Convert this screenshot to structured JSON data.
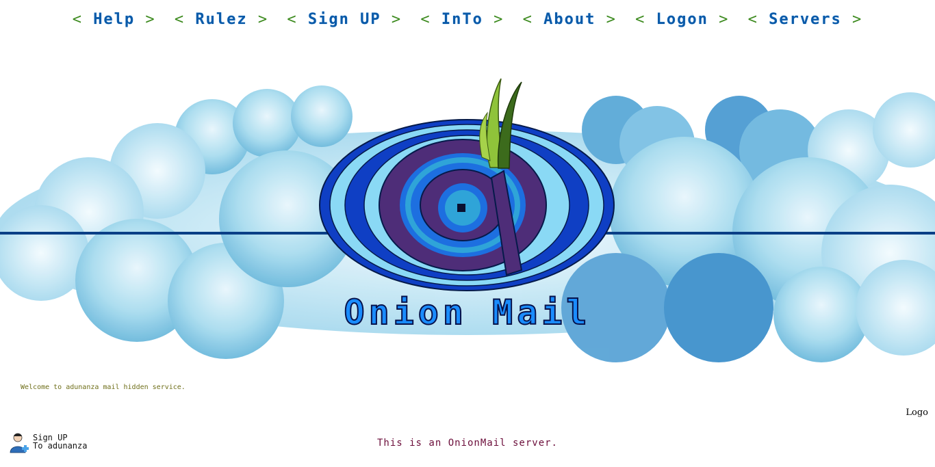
{
  "nav": {
    "open": "<",
    "close": ">",
    "items": [
      {
        "label": "Help"
      },
      {
        "label": "Rulez"
      },
      {
        "label": "Sign UP"
      },
      {
        "label": "InTo"
      },
      {
        "label": "About"
      },
      {
        "label": "Logon"
      },
      {
        "label": "Servers"
      }
    ]
  },
  "banner": {
    "brand": "Onion Mail",
    "logo_icon": "onion-at-sign-icon",
    "colors": {
      "cloud": "#8fd0e8",
      "line": "#0a3f86",
      "ring_dark": "#0f3fc4",
      "ring_light": "#8ad9f5",
      "purple": "#4e2d78",
      "leaf": "#8fc33a"
    }
  },
  "welcome": "Welcome to adunanza mail hidden service.",
  "logo_label": "Logo",
  "signup": {
    "icon": "user-add-icon",
    "line1": "Sign UP",
    "line2": "To adunanza"
  },
  "footer": "This is an OnionMail server."
}
